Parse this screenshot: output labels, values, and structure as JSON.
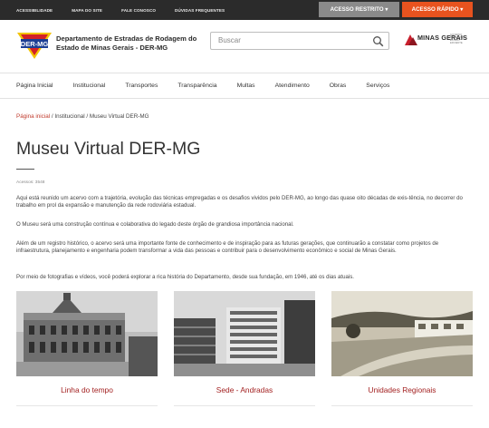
{
  "topbar": {
    "links": [
      "ACESSIBILIDADE",
      "MAPA DO SITE",
      "FALE CONOSCO",
      "DÚVIDAS FREQUENTES"
    ],
    "acesso_restrito": "ACESSO RESTRITO",
    "acesso_rapido": "ACESSO RÁPIDO"
  },
  "header": {
    "logo_text": "DER-MG",
    "org_line1": "Departamento de Estradas de Rodagem do",
    "org_line2": "Estado de Minas Gerais - DER-MG",
    "search_placeholder": "Buscar",
    "mg_logo": "MINAS GERAIS",
    "mg_sub": "GOVERNO DIFERENTE. ESTADO EFICIENTE."
  },
  "nav": {
    "items": [
      "Página Inicial",
      "Institucional",
      "Transportes",
      "Transparência",
      "Multas",
      "Atendimento",
      "Obras",
      "Serviços"
    ]
  },
  "breadcrumb": {
    "home": "Página inicial",
    "sep1": " / ",
    "section": "Institucional",
    "sep2": " / ",
    "current": "Museu Virtual DER-MG"
  },
  "page": {
    "title": "Museu Virtual DER-MG",
    "hits": "Acessos: 3548",
    "paragraphs": [
      "Aqui está reunido um acervo com a trajetória, evolução das técnicas empregadas e os desafios vividos pelo DER-MG, ao longo das quase oito décadas de exis-tência, no decorrer do trabalho em prol da expansão e manutenção da rede rodoviária estadual.",
      "O Museu será uma construção contínua e colaborativa do legado deste órgão de grandiosa importância nacional.",
      "Além de um registro histórico, o acervo será uma importante fonte de conhecimento e de inspiração para as futuras gerações, que continuarão a constatar como projetos de infraestrutura, planejamento e engenharia podem transformar a vida das pessoas e contribuir para o desenvolvimento econômico e social de Minas Gerais.",
      "Por meio de fotografias e vídeos, você poderá explorar a rica história do Departamento, desde sua fundação, em 1946, até os dias atuais."
    ]
  },
  "cards": [
    {
      "caption": "Linha do tempo"
    },
    {
      "caption": "Sede - Andradas"
    },
    {
      "caption": "Unidades Regionais"
    }
  ],
  "colors": {
    "topbar_bg": "#2b2b2b",
    "restrito_bg": "#8a8a8a",
    "rapido_bg": "#e8531f",
    "caption": "#a32121",
    "logo_red": "#d32027",
    "logo_yellow": "#f3c300",
    "logo_blue": "#1c3f94"
  }
}
